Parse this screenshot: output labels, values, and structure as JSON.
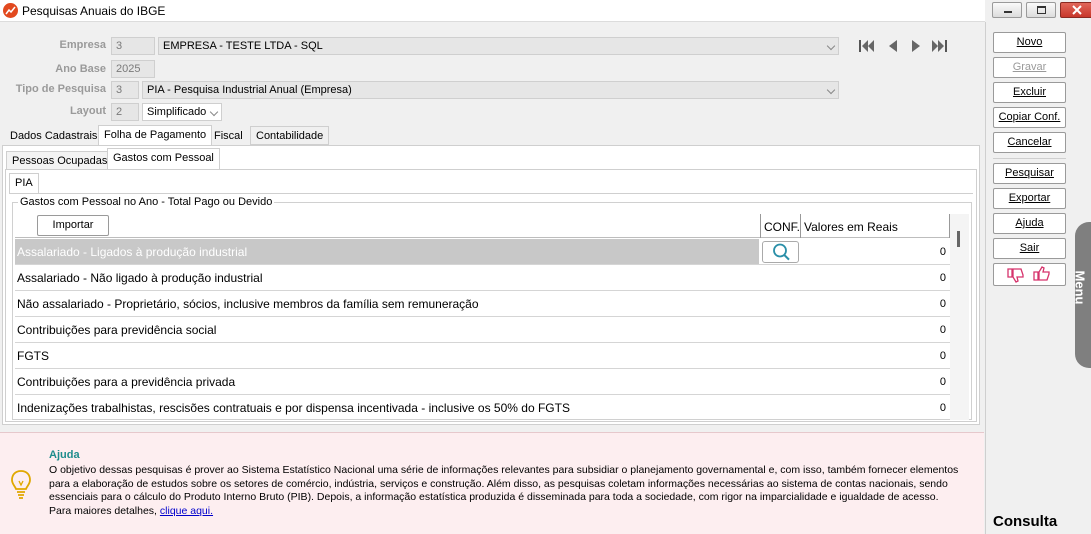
{
  "window": {
    "title": "Pesquisas Anuais do IBGE"
  },
  "form": {
    "empresa": {
      "label": "Empresa",
      "code": "3",
      "value": "EMPRESA - TESTE LTDA - SQL"
    },
    "ano_base": {
      "label": "Ano Base",
      "value": "2025"
    },
    "tipo_pesquisa": {
      "label": "Tipo de Pesquisa",
      "code": "3",
      "value": "PIA - Pesquisa Industrial Anual (Empresa)"
    },
    "layout": {
      "label": "Layout",
      "code": "2",
      "value": "Simplificado"
    }
  },
  "tabs": [
    "Dados Cadastrais",
    "Folha de Pagamento",
    "Fiscal",
    "Contabilidade"
  ],
  "subtabs": [
    "Pessoas Ocupadas",
    "Gastos com Pessoal"
  ],
  "inner_tab": "PIA",
  "group": {
    "title": "Gastos com Pessoal no Ano - Total Pago ou Devido",
    "import_label": "Importar",
    "col_conf": "CONF.",
    "col_values": "Valores em Reais",
    "rows": [
      {
        "desc": "Assalariado - Ligados à produção industrial",
        "value": "0"
      },
      {
        "desc": "Assalariado - Não ligado à produção industrial",
        "value": "0"
      },
      {
        "desc": "Não assalariado - Proprietário, sócios, inclusive membros da família sem remuneração",
        "value": "0"
      },
      {
        "desc": "Contribuições para previdência social",
        "value": "0"
      },
      {
        "desc": "FGTS",
        "value": "0"
      },
      {
        "desc": "Contribuições para a previdência privada",
        "value": "0"
      },
      {
        "desc": "Indenizações trabalhistas, rescisões contratuais e por dispensa incentivada - inclusive os 50% do FGTS",
        "value": "0"
      }
    ]
  },
  "actions": {
    "novo": "Novo",
    "gravar": "Gravar",
    "excluir": "Excluir",
    "copiar": "Copiar Conf.",
    "cancelar": "Cancelar",
    "pesquisar": "Pesquisar",
    "exportar": "Exportar",
    "ajuda": "Ajuda",
    "sair": "Sair"
  },
  "menu_tab": "Menu",
  "mode": "Consulta",
  "help": {
    "title": "Ajuda",
    "text": "O objetivo dessas pesquisas é prover ao Sistema Estatístico Nacional uma série de informações relevantes para subsidiar o planejamento governamental e, com isso, também fornecer elementos para a elaboração de estudos sobre os setores de comércio, indústria, serviços e construção. Além disso, as pesquisas coletam informações necessárias ao sistema de contas nacionais, sendo essenciais para o cálculo do Produto Interno Bruto (PIB). Depois, a informação estatística produzida é disseminada para toda a sociedade, com rigor na imparcialidade e igualdade de acesso.",
    "more_prefix": "Para maiores detalhes,",
    "link": "clique aqui."
  }
}
